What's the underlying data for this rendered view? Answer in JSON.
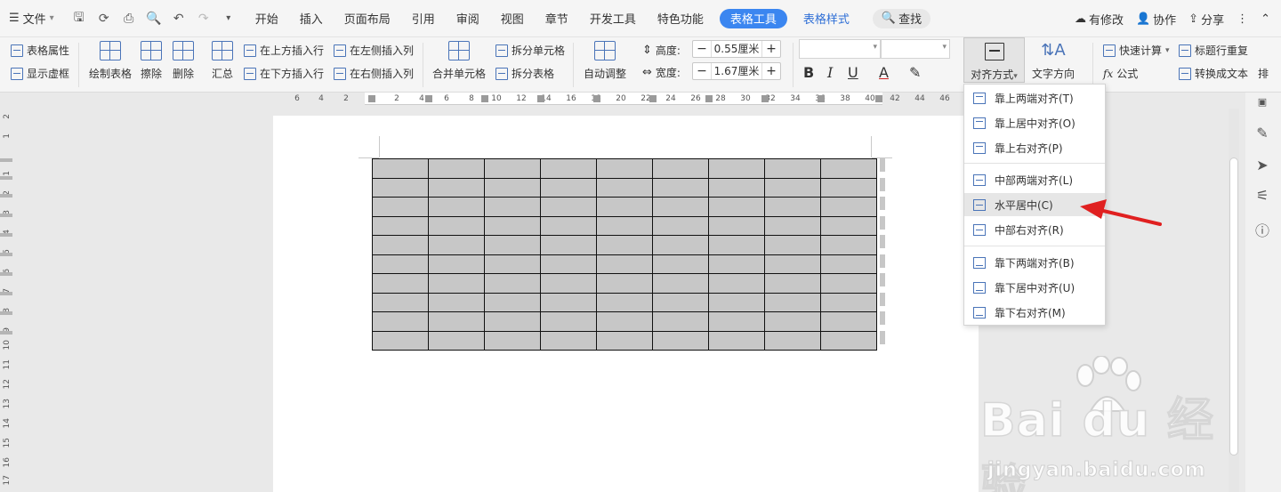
{
  "menubar": {
    "file_label": "文件",
    "tabs": [
      "开始",
      "插入",
      "页面布局",
      "引用",
      "审阅",
      "视图",
      "章节",
      "开发工具",
      "特色功能"
    ],
    "active_tab": "表格工具",
    "style_tab": "表格样式",
    "search_label": "查找",
    "right": {
      "changes": "有修改",
      "collab": "协作",
      "share": "分享"
    }
  },
  "ribbon": {
    "table_props": "表格属性",
    "show_gridlines": "显示虚框",
    "draw_table": "绘制表格",
    "erase": "擦除",
    "delete": "删除",
    "summary": "汇总",
    "insert_row_above": "在上方插入行",
    "insert_row_below": "在下方插入行",
    "insert_col_left": "在左侧插入列",
    "insert_col_right": "在右侧插入列",
    "merge_cells": "合并单元格",
    "split_cells": "拆分单元格",
    "split_table": "拆分表格",
    "auto_fit": "自动调整",
    "height_label": "高度:",
    "height_value": "0.55厘米",
    "width_label": "宽度:",
    "width_value": "1.67厘米",
    "align_label": "对齐方式",
    "text_direction": "文字方向",
    "quick_calc": "快速计算",
    "formula": "公式",
    "header_repeat": "标题行重复",
    "convert_text": "转换成文本",
    "sort_partial": "排"
  },
  "ruler": {
    "h_ticks": [
      "6",
      "4",
      "2",
      "2",
      "4",
      "6",
      "8",
      "10",
      "12",
      "14",
      "16",
      "18",
      "20",
      "22",
      "24",
      "26",
      "28",
      "30",
      "32",
      "34",
      "36",
      "38",
      "40",
      "42",
      "44",
      "46"
    ],
    "v_ticks": [
      "2",
      "1",
      "1",
      "2",
      "3",
      "4",
      "5",
      "6",
      "7",
      "8",
      "9",
      "10",
      "11",
      "12",
      "13",
      "14",
      "15",
      "16",
      "17"
    ]
  },
  "table": {
    "rows": 10,
    "cols": 9
  },
  "dropdown": {
    "items": [
      "靠上两端对齐(T)",
      "靠上居中对齐(O)",
      "靠上右对齐(P)",
      "中部两端对齐(L)",
      "水平居中(C)",
      "中部右对齐(R)",
      "靠下两端对齐(B)",
      "靠下居中对齐(U)",
      "靠下右对齐(M)"
    ],
    "highlighted_index": 4
  },
  "watermark": {
    "logo": "Bai du 经验",
    "url": "jingyan.baidu.com"
  },
  "colors": {
    "accent": "#3b86f0",
    "arrow": "#e02020",
    "table_fill": "#c7c7c7"
  }
}
